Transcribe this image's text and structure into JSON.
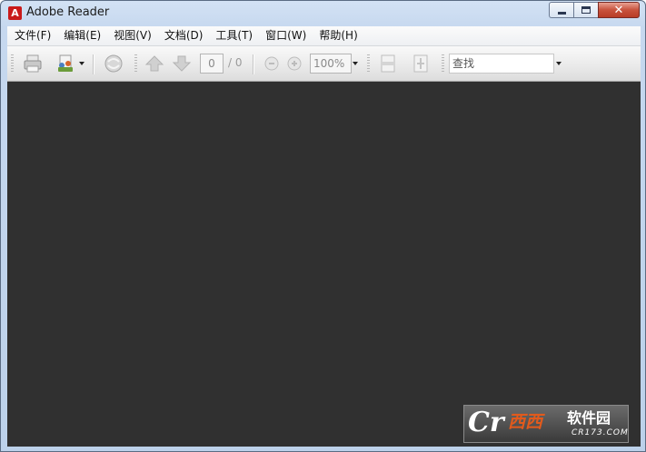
{
  "window": {
    "title": "Adobe Reader",
    "app_icon": "pdf-icon",
    "close_glyph": "✕"
  },
  "menu": {
    "items": [
      "文件(F)",
      "编辑(E)",
      "视图(V)",
      "文档(D)",
      "工具(T)",
      "窗口(W)",
      "帮助(H)"
    ]
  },
  "toolbar": {
    "page_current": "0",
    "page_total": "/ 0",
    "zoom": "100%",
    "search_placeholder": "查找",
    "icons": [
      "print-icon",
      "share-icon",
      "collaborate-icon",
      "prev-page-icon",
      "next-page-icon",
      "zoom-out-icon",
      "zoom-in-icon",
      "fit-width-icon",
      "fit-page-icon"
    ]
  },
  "watermark": {
    "logo": "Cr",
    "brand": "西西",
    "text": "软件园",
    "url": "CR173.COM"
  },
  "colors": {
    "document_background": "#303030",
    "close_button": "#c8523c",
    "brand_orange": "#e25a1c"
  }
}
